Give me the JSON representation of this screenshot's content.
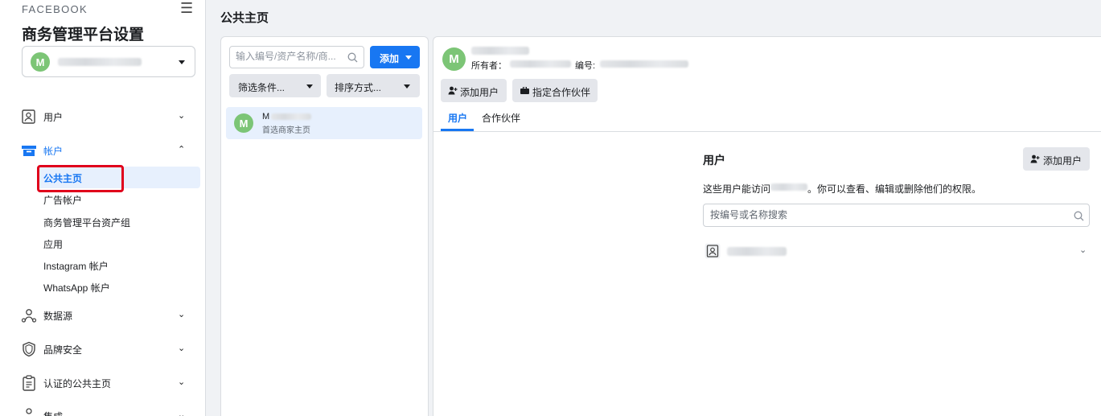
{
  "sidebar": {
    "brand": "FACEBOOK",
    "title": "商务管理平台设置",
    "account_avatar": "M",
    "nav": [
      {
        "label": "用户",
        "icon": "user-badge-icon"
      },
      {
        "label": "帐户",
        "icon": "briefcase-icon"
      },
      {
        "label": "数据源",
        "icon": "data-sources-icon"
      },
      {
        "label": "品牌安全",
        "icon": "shield-icon"
      },
      {
        "label": "认证的公共主页",
        "icon": "clipboard-icon"
      },
      {
        "label": "集成",
        "icon": "integrations-icon"
      }
    ],
    "sub_items": [
      "公共主页",
      "广告帐户",
      "商务管理平台资产组",
      "应用",
      "Instagram 帐户",
      "WhatsApp 帐户"
    ]
  },
  "header": {
    "title": "公共主页"
  },
  "list": {
    "search_placeholder": "输入编号/资产名称/商...",
    "add_label": "添加",
    "filter_label": "筛选条件...",
    "sort_label": "排序方式...",
    "items": [
      {
        "avatar": "M",
        "name": "M",
        "subtitle": "首选商家主页"
      }
    ]
  },
  "detail": {
    "avatar": "M",
    "owner_label": "所有者：",
    "id_label": "编号:",
    "add_user_button": "添加用户",
    "assign_partner_button": "指定合作伙伴",
    "tabs": [
      "用户",
      "合作伙伴"
    ],
    "users_section": {
      "title": "用户",
      "add_user_button": "添加用户",
      "desc_prefix": "这些用户能访问",
      "desc_suffix": "。你可以查看、编辑或删除他们的权限。",
      "search_placeholder": "按编号或名称搜索"
    }
  },
  "colors": {
    "primary": "#1877f2",
    "active_bg": "#e7f0fd",
    "highlight_red": "#e0001b",
    "avatar_green": "#7cc576"
  }
}
